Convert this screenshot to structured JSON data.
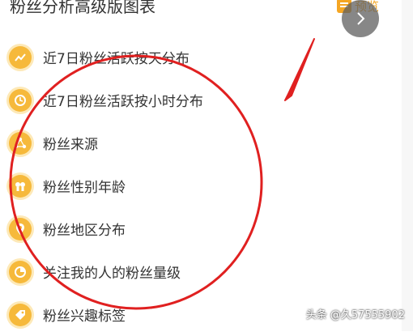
{
  "header": {
    "title": "粉丝分析高级版图表"
  },
  "preview": {
    "label": "预览",
    "icon": "document-icon"
  },
  "next_button": {
    "icon": "chevron-right-icon"
  },
  "items": [
    {
      "label": "近7日粉丝活跃按天分布",
      "icon": "trend-icon"
    },
    {
      "label": "近7日粉丝活跃按小时分布",
      "icon": "clock-icon"
    },
    {
      "label": "粉丝来源",
      "icon": "share-nodes-icon"
    },
    {
      "label": "粉丝性别年龄",
      "icon": "gender-icon"
    },
    {
      "label": "粉丝地区分布",
      "icon": "location-pin-icon"
    },
    {
      "label": "关注我的人的粉丝量级",
      "icon": "pie-chart-icon"
    },
    {
      "label": "粉丝兴趣标签",
      "icon": "tag-icon"
    }
  ],
  "watermark": "头条 @久57555902",
  "colors": {
    "accent": "#f6b93b",
    "annotation": "#e02020",
    "text": "#333333"
  }
}
